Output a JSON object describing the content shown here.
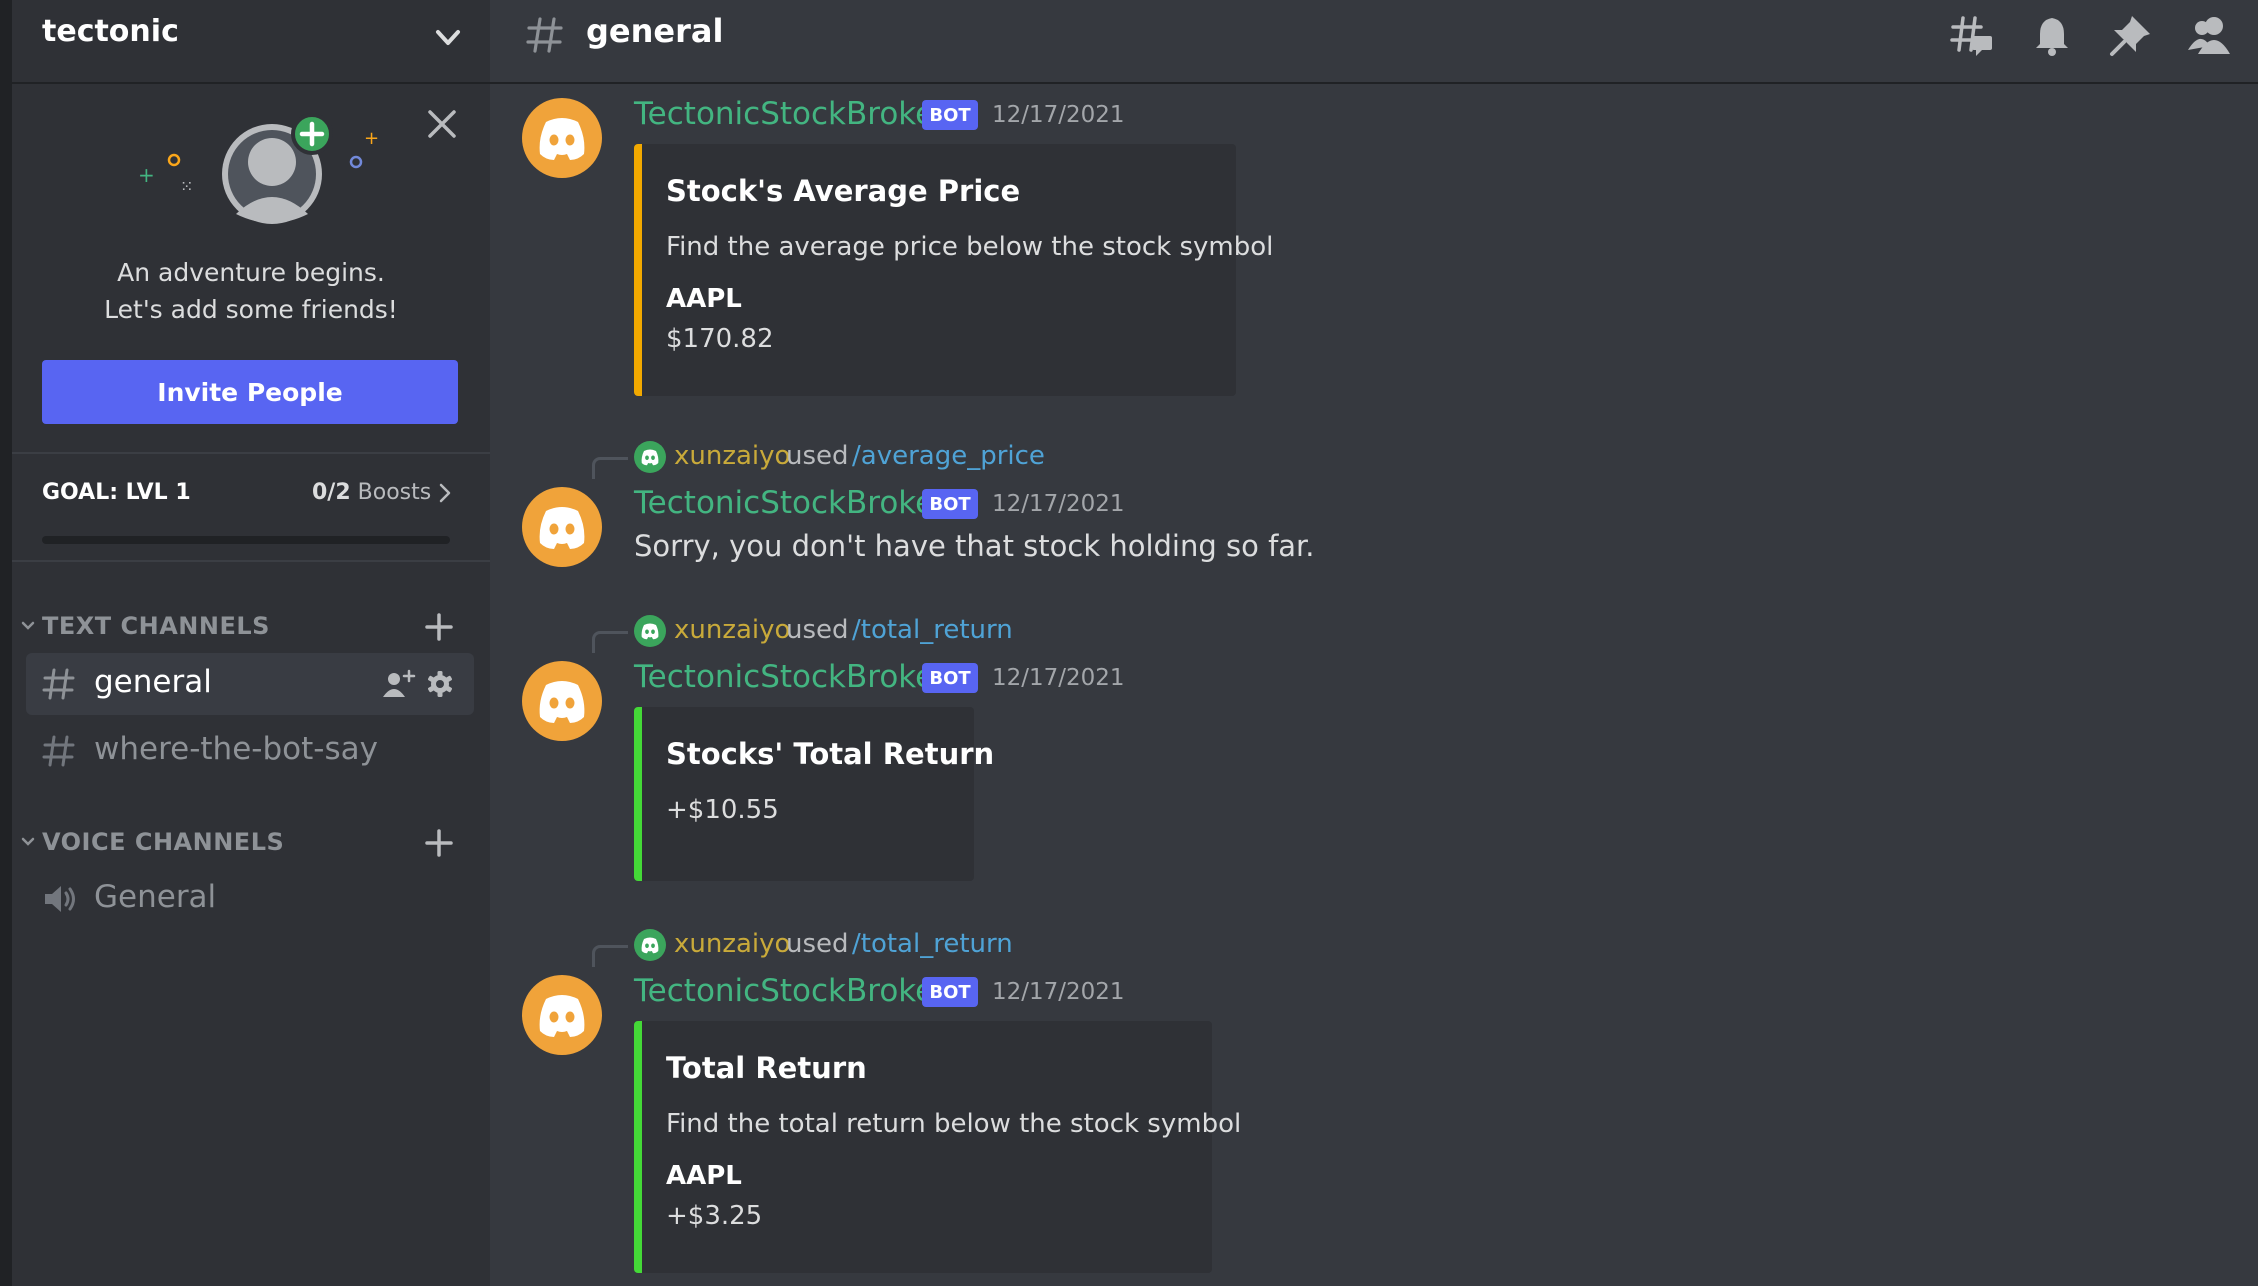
{
  "server": {
    "name": "tectonic"
  },
  "invite_card": {
    "line1": "An adventure begins.",
    "line2": "Let's add some friends!",
    "button": "Invite People"
  },
  "boost": {
    "goal": "GOAL: LVL 1",
    "count": "0/2",
    "label": "Boosts",
    "progress": 0
  },
  "categories": {
    "text": "TEXT CHANNELS",
    "voice": "VOICE CHANNELS"
  },
  "channels": {
    "text": [
      {
        "name": "general",
        "active": true
      },
      {
        "name": "where-the-bot-say",
        "active": false
      }
    ],
    "voice": [
      {
        "name": "General"
      }
    ]
  },
  "topbar": {
    "channel": "general",
    "icons": [
      "threads-icon",
      "bell-icon",
      "pin-icon",
      "members-icon"
    ]
  },
  "messages": [
    {
      "author": "TectonicStockBroker",
      "badge": "BOT",
      "timestamp": "12/17/2021",
      "embed": {
        "title": "Stock's Average Price",
        "description": "Find the average price below the stock symbol",
        "field_name": "AAPL",
        "field_value": "$170.82",
        "color": "#f2a900"
      }
    },
    {
      "reply": {
        "user": "xunzaiyo",
        "used": "used",
        "command": "/average_price"
      },
      "author": "TectonicStockBroker",
      "badge": "BOT",
      "timestamp": "12/17/2021",
      "text": "Sorry, you don't have that stock holding so far."
    },
    {
      "reply": {
        "user": "xunzaiyo",
        "used": "used",
        "command": "/total_return"
      },
      "author": "TectonicStockBroker",
      "badge": "BOT",
      "timestamp": "12/17/2021",
      "embed": {
        "title": "Stocks' Total Return",
        "description": "+$10.55",
        "color": "#44d937"
      }
    },
    {
      "reply": {
        "user": "xunzaiyo",
        "used": "used",
        "command": "/total_return"
      },
      "author": "TectonicStockBroker",
      "badge": "BOT",
      "timestamp": "12/17/2021",
      "embed": {
        "title": "Total Return",
        "description": "Find the total return below the stock symbol",
        "field_name": "AAPL",
        "field_value": "+$3.25",
        "color": "#44d937"
      }
    }
  ],
  "colors": {
    "accent": "#5865f2",
    "bot_name": "#43b581",
    "avatar": "#f0a33a",
    "user_name": "#c9aa3a",
    "command": "#4fa3d6"
  }
}
